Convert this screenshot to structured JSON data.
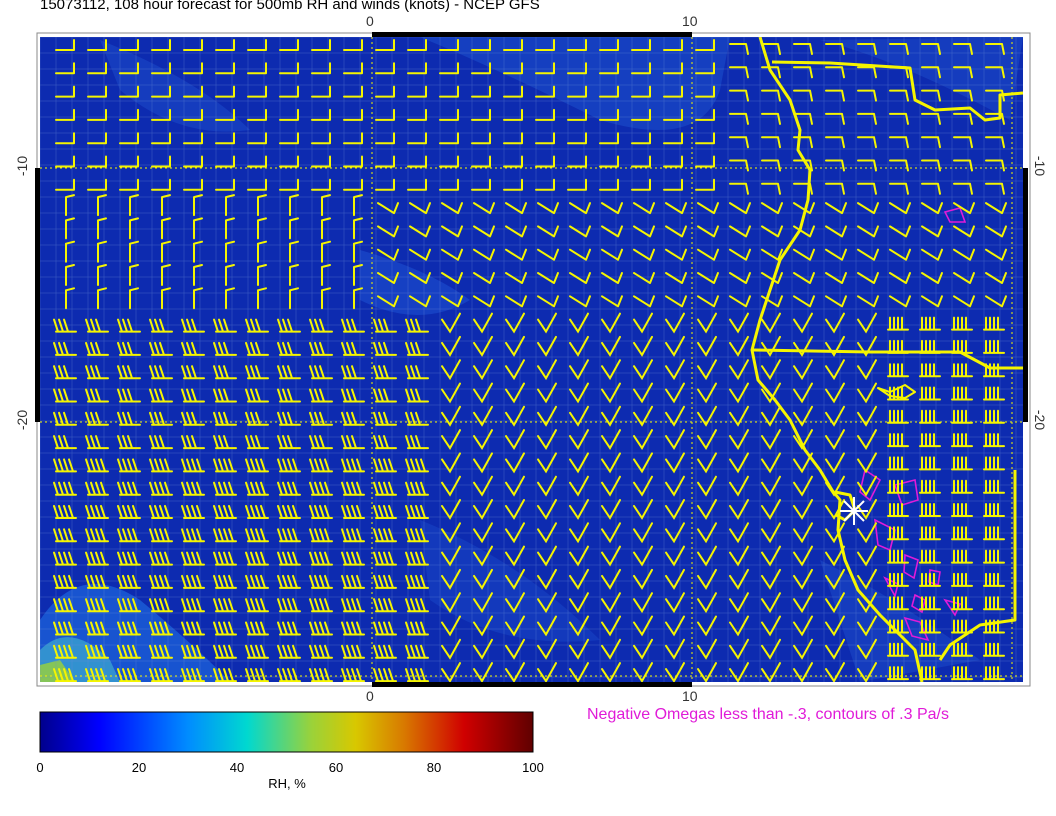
{
  "title": "15073112, 108 hour forecast for 500mb RH and winds (knots) - NCEP GFS",
  "x_ticks": [
    "0",
    "10"
  ],
  "y_ticks": [
    "-10",
    "-20"
  ],
  "omega_note": "Negative Omegas less than -.3, contours of .3 Pa/s",
  "colorbar": {
    "label": "RH, %",
    "ticks": [
      "0",
      "20",
      "40",
      "60",
      "80",
      "100"
    ],
    "range": [
      0,
      100
    ],
    "colors": [
      "#00008b",
      "#0000ff",
      "#00a0ff",
      "#00d8d0",
      "#9ad23a",
      "#d8c800",
      "#d87800",
      "#d00000",
      "#600000"
    ]
  },
  "colors": {
    "ocean_fill": "#0d2bb0",
    "barbs": "#f5f500",
    "coast": "#f5f500",
    "omega": "#e01bd8",
    "grid": "#6a8dd6"
  },
  "map": {
    "lon_range": [
      -11,
      20
    ],
    "lat_range": [
      -27,
      -8
    ],
    "marker": "asterisk"
  }
}
